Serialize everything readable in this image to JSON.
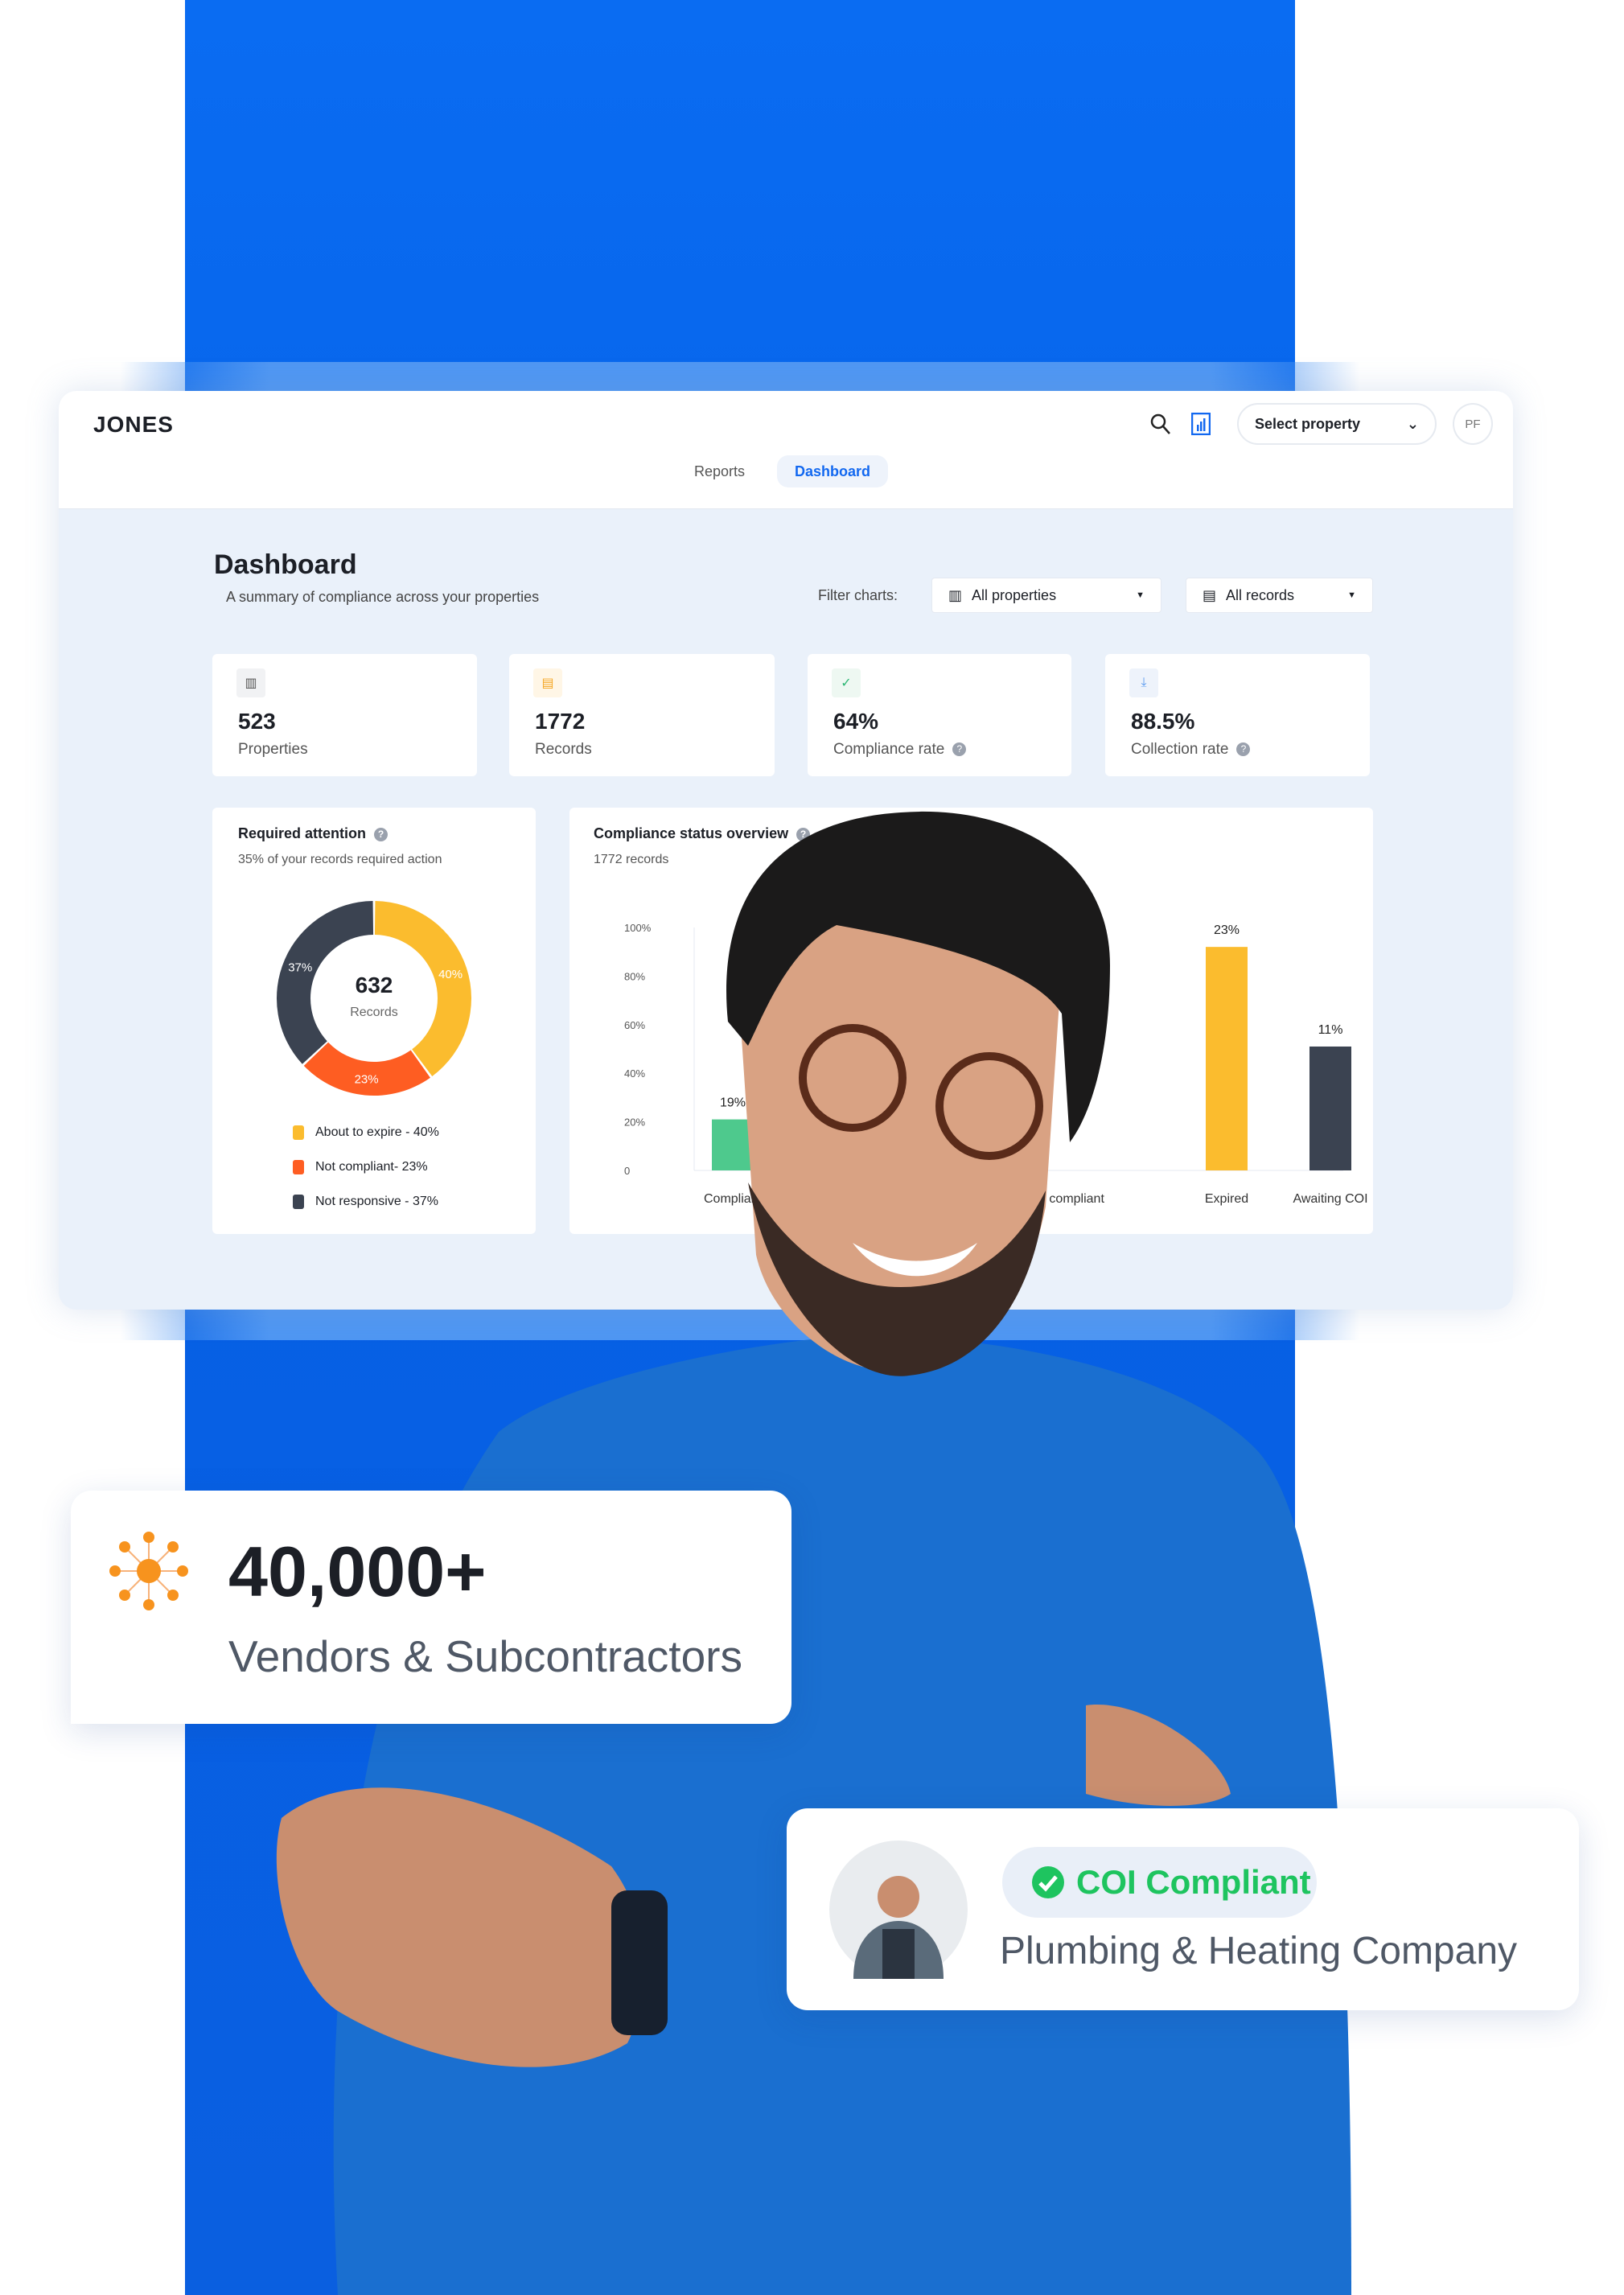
{
  "app": {
    "logo": "JONES",
    "select_property": "Select property",
    "avatar_initials": "PF"
  },
  "tabs": [
    {
      "label": "Reports",
      "active": false
    },
    {
      "label": "Dashboard",
      "active": true
    }
  ],
  "page": {
    "title": "Dashboard",
    "subtitle": "A summary of compliance across your properties"
  },
  "filters": {
    "label": "Filter charts:",
    "properties": "All properties",
    "records": "All records"
  },
  "stats": [
    {
      "value": "523",
      "label": "Properties",
      "icon": "building-icon"
    },
    {
      "value": "1772",
      "label": "Records",
      "icon": "document-icon"
    },
    {
      "value": "64%",
      "label": "Compliance rate",
      "icon": "check-icon",
      "help": true
    },
    {
      "value": "88.5%",
      "label": "Collection rate",
      "icon": "download-icon",
      "help": true
    }
  ],
  "attention": {
    "title": "Required attention",
    "subtitle": "35% of your records required action",
    "center_value": "632",
    "center_label": "Records",
    "legend": [
      {
        "label": "About to expire - 40%",
        "color": "#fbbc2e"
      },
      {
        "label": "Not compliant- 23%",
        "color": "#fe5d22"
      },
      {
        "label": "Not responsive - 37%",
        "color": "#3b4351"
      }
    ]
  },
  "chart_data": [
    {
      "type": "pie",
      "title": "Required attention",
      "donut": true,
      "slices": [
        {
          "label": "About to expire",
          "value": 40,
          "color": "#fbbc2e"
        },
        {
          "label": "Not compliant",
          "value": 23,
          "color": "#fe5d22"
        },
        {
          "label": "Not responsive",
          "value": 37,
          "color": "#3b4351"
        }
      ],
      "slice_labels": [
        "40%",
        "23%",
        "37%"
      ]
    },
    {
      "type": "bar",
      "title": "Compliance status overview",
      "subtitle": "1772 records",
      "yticks": [
        "100%",
        "80%",
        "60%",
        "40%",
        "20%",
        "0"
      ],
      "ylim": [
        0,
        100
      ],
      "categories": [
        "Compliant",
        "Not compliant",
        "Expired",
        "Awaiting COI"
      ],
      "category_labels_visible": [
        "Complian",
        "mpliant",
        "Expired",
        "Awaiting COI"
      ],
      "values": [
        21,
        null,
        92,
        51
      ],
      "data_labels": [
        "19%",
        "",
        "23%",
        "11%"
      ],
      "colors": [
        "#4ec98d",
        "#fe5d22",
        "#fbbc2e",
        "#3b4351"
      ]
    }
  ],
  "promo": {
    "count": "40,000+",
    "count_label": "Vendors & Subcontractors",
    "badge": "COI Compliant",
    "company": "Plumbing & Heating Company"
  },
  "colors": {
    "brand_blue": "#0a6cf2",
    "accent_orange": "#f7931e",
    "success_green": "#1ec45f"
  }
}
